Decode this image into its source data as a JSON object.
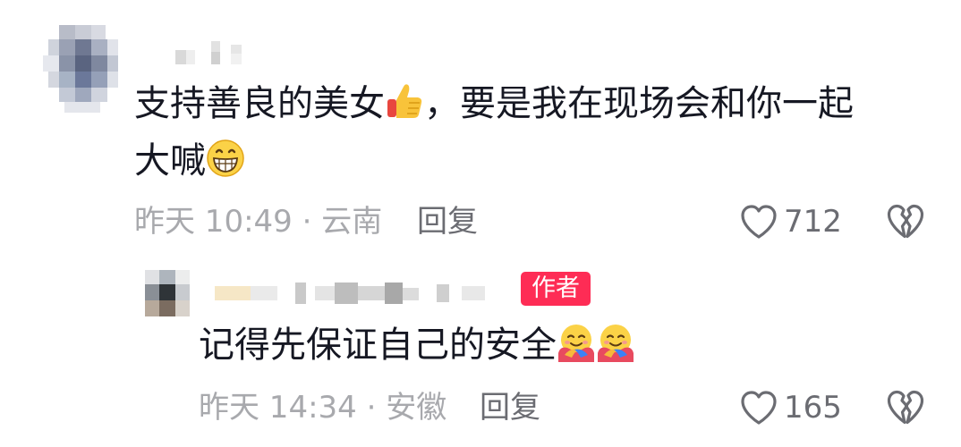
{
  "comment": {
    "text_line1": "支持善良的美女",
    "text_line1_emoji": "thumbs-up-emoji",
    "text_line1b": "，要是我在现场会和你一起",
    "text_line2": "大喊",
    "text_line2_emoji": "grinning-face-emoji",
    "meta": "昨天 10:49 · 云南",
    "reply_label": "回复",
    "like_count": "712",
    "like_icon": "heart-outline-icon",
    "dislike_icon": "broken-heart-icon"
  },
  "reply": {
    "badge_label": "作者",
    "text": "记得先保证自己的安全",
    "text_emoji": "hugging-face-emoji",
    "meta": "昨天 14:34 · 安徽",
    "reply_label": "回复",
    "like_count": "165",
    "like_icon": "heart-outline-icon",
    "dislike_icon": "broken-heart-icon"
  },
  "colors": {
    "badge": "#fe2c55",
    "meta_text": "#a8a9ad",
    "action_text": "#6b6c72",
    "body_text": "#161823"
  }
}
